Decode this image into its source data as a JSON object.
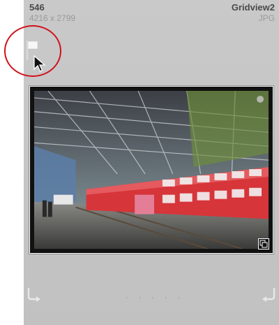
{
  "cell": {
    "number": "546",
    "dimensions": "4216 x 2799",
    "filename": "Gridview2",
    "filetype": "JPG",
    "flag_icon": "white-flag-icon",
    "cursor_icon": "arrow-cursor-icon",
    "stack_icon": "stack-badge-icon",
    "rotate_left_icon": "rotate-left-icon",
    "rotate_right_icon": "rotate-right-icon",
    "rating_dots": "· · · · ·",
    "highlight_color": "#d0111b"
  }
}
